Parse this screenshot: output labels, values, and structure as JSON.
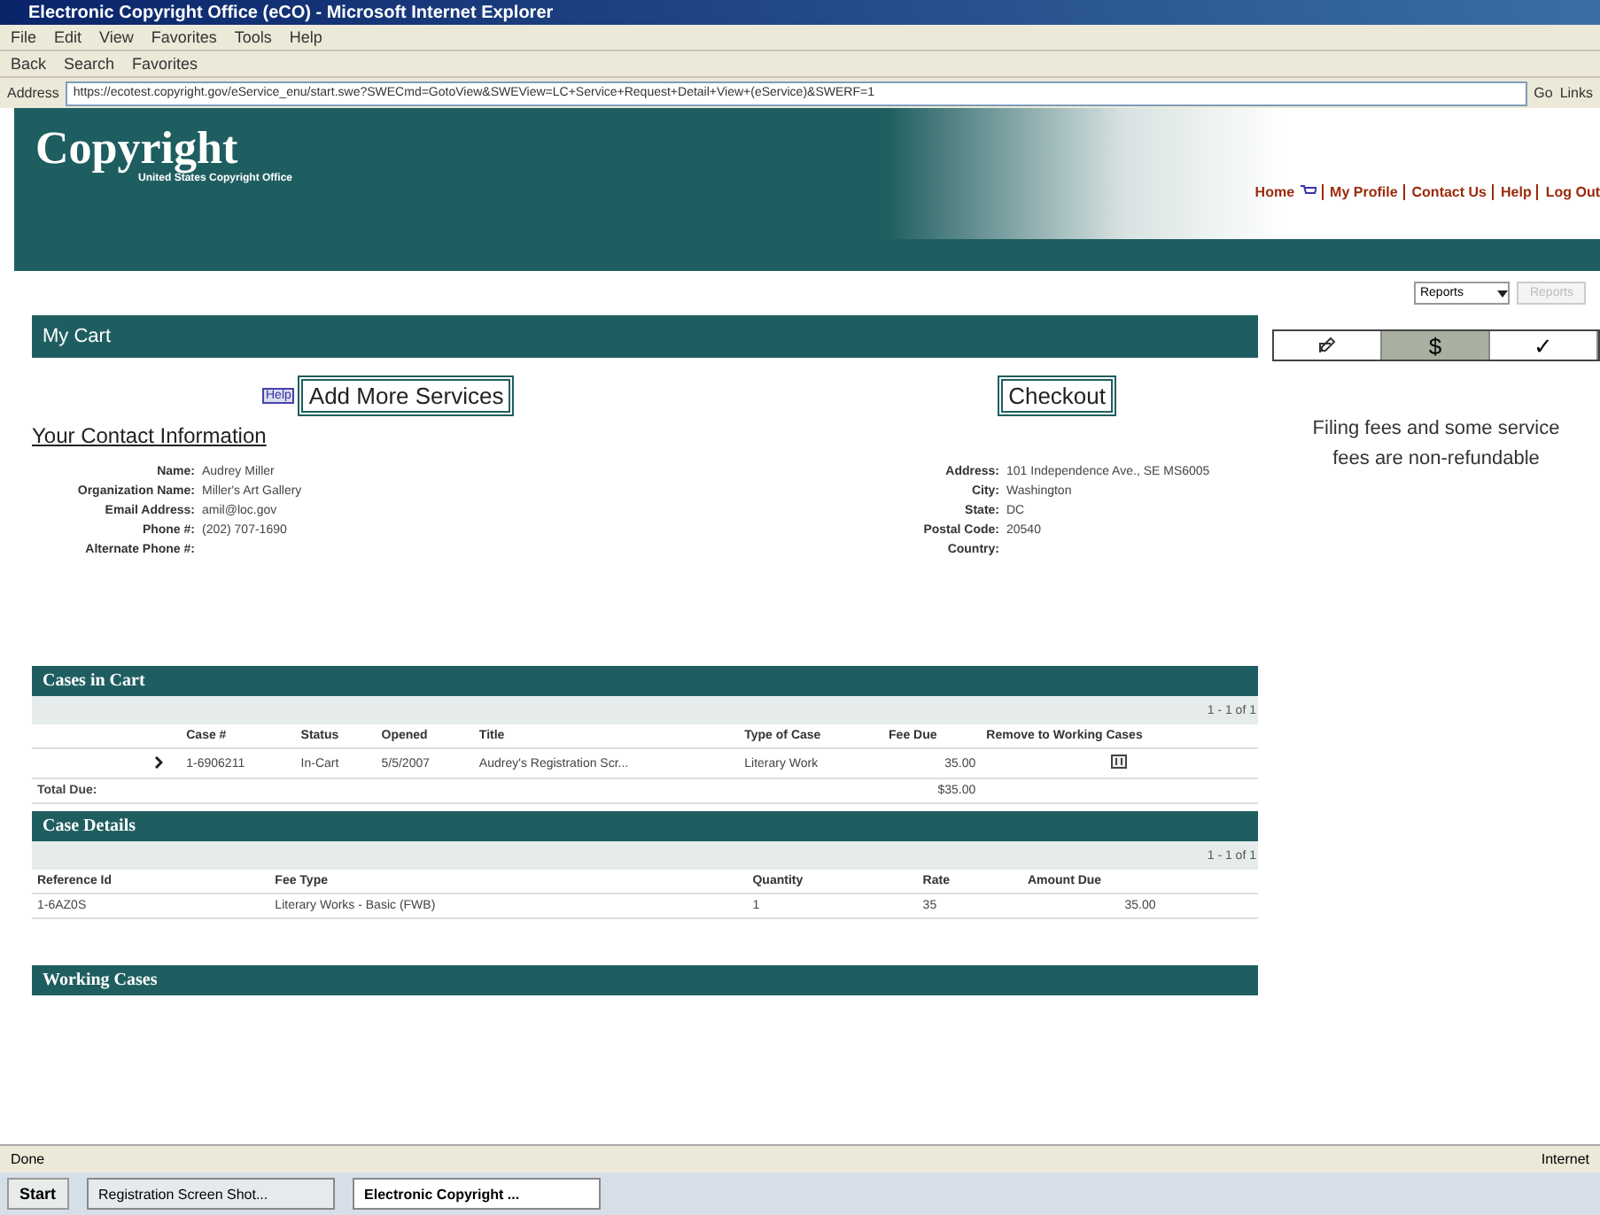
{
  "window": {
    "title": "Electronic Copyright Office (eCO) - Microsoft Internet Explorer"
  },
  "menu": [
    "File",
    "Edit",
    "View",
    "Favorites",
    "Tools",
    "Help"
  ],
  "toolbar": [
    "Back",
    "Search",
    "Favorites"
  ],
  "address": {
    "label": "Address",
    "value": "https://ecotest.copyright.gov/eService_enu/start.swe?SWECmd=GotoView&SWEView=LC+Service+Request+Detail+View+(eService)&SWERF=1",
    "go": "Go",
    "links": "Links"
  },
  "site": {
    "logo": "Copyright",
    "tagline": "United States Copyright Office",
    "nav": [
      "Home",
      "My Profile",
      "Contact Us",
      "Help",
      "Log Out"
    ],
    "reports": {
      "value": "Reports",
      "button": "Reports"
    }
  },
  "cart": {
    "title": "My Cart",
    "help": "Help",
    "add": "Add More Services",
    "checkout": "Checkout",
    "contact_heading": "Your Contact Information",
    "left": [
      {
        "label": "Name:",
        "value": "Audrey Miller"
      },
      {
        "label": "Organization Name:",
        "value": "Miller's Art Gallery"
      },
      {
        "label": "Email Address:",
        "value": "amil@loc.gov"
      },
      {
        "label": "Phone #:",
        "value": "(202) 707-1690"
      },
      {
        "label": "Alternate Phone #:"
      }
    ],
    "right": [
      {
        "label": "Address:",
        "value": "101 Independence Ave., SE MS6005"
      },
      {
        "label": "City:",
        "value": "Washington"
      },
      {
        "label": "State:",
        "value": "DC"
      },
      {
        "label": "Postal Code:",
        "value": "20540"
      },
      {
        "label": "Country:"
      }
    ]
  },
  "steps": [
    {
      "kind": "icon",
      "selected": false
    },
    {
      "kind": "text",
      "text": "$",
      "selected": true
    },
    {
      "kind": "text",
      "text": "✓",
      "selected": false
    }
  ],
  "notice": "Filing fees and some service fees are non-refundable",
  "cases": {
    "title": "Cases in Cart",
    "pager": "1 - 1 of 1",
    "columns": [
      "Case #",
      "Status",
      "Opened",
      "Title",
      "Type of Case",
      "Fee Due",
      "Remove to Working Cases"
    ],
    "rows": [
      {
        "case": "1-6906211",
        "status": "In-Cart",
        "opened": "5/5/2007",
        "title": "Audrey's Registration Scr...",
        "type": "Literary Work",
        "fee": "35.00"
      }
    ],
    "total_label": "Total Due:",
    "total": "$35.00"
  },
  "details": {
    "title": "Case Details",
    "pager": "1 - 1 of 1",
    "columns": [
      "Reference Id",
      "Fee Type",
      "Quantity",
      "Rate",
      "Amount Due"
    ],
    "rows": [
      [
        "1-6AZ0S",
        "Literary Works - Basic (FWB)",
        "1",
        "35",
        "35.00"
      ]
    ]
  },
  "working": {
    "title": "Working Cases"
  },
  "status_bar": {
    "text": "Done",
    "zone": "Internet"
  },
  "taskbar": {
    "start": "Start",
    "items": [
      {
        "label": "Registration Screen Shot...",
        "selected": false
      },
      {
        "label": "Electronic Copyright ...",
        "selected": true
      }
    ]
  }
}
